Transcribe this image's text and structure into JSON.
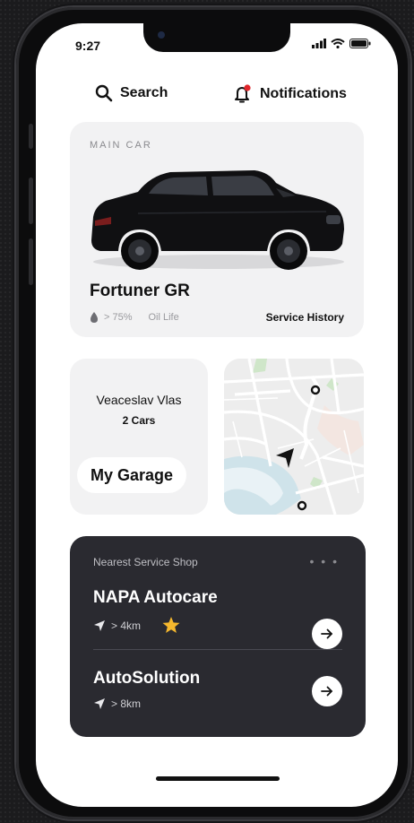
{
  "status_bar": {
    "time": "9:27"
  },
  "header": {
    "search_label": "Search",
    "notifications_label": "Notifications"
  },
  "main_car": {
    "section_label": "MAIN CAR",
    "car_name": "Fortuner GR",
    "oil_percent": "> 75%",
    "oil_label": "Oil Life",
    "service_history_label": "Service History"
  },
  "garage": {
    "owner_name": "Veaceslav Vlas",
    "cars_count": "2 Cars",
    "button_label": "My Garage"
  },
  "service_shops": {
    "title": "Nearest Service Shop",
    "more": "• • •",
    "items": [
      {
        "name": "NAPA Autocare",
        "distance": "> 4km",
        "starred": true
      },
      {
        "name": "AutoSolution",
        "distance": "> 8km",
        "starred": false
      }
    ]
  },
  "colors": {
    "accent_red": "#e0262b",
    "star_yellow": "#f5b82e",
    "dark_card": "#2a2a30"
  }
}
